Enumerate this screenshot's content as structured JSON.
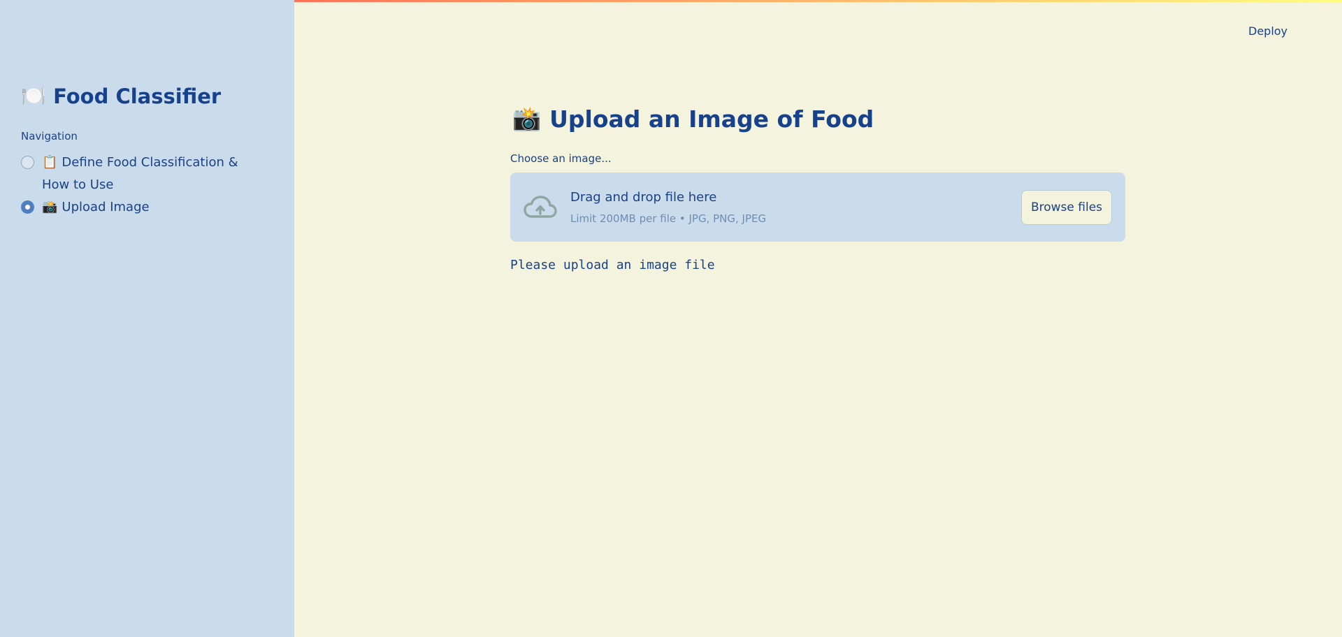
{
  "header": {
    "deploy_label": "Deploy"
  },
  "sidebar": {
    "title_icon": "🍽️",
    "title": "Food Classifier",
    "nav_label": "Navigation",
    "options": [
      {
        "icon": "📋",
        "label": "Define Food Classification & How to Use",
        "selected": false
      },
      {
        "icon": "📸",
        "label": "Upload Image",
        "selected": true
      }
    ]
  },
  "main": {
    "title_icon": "📸",
    "title": "Upload an Image of Food",
    "uploader": {
      "label": "Choose an image...",
      "drop_text": "Drag and drop file here",
      "limit_text": "Limit 200MB per file • JPG, PNG, JPEG",
      "browse_label": "Browse files",
      "icon": "cloud-upload-icon"
    },
    "message": "Please upload an image file"
  },
  "colors": {
    "background": "#f3f3de",
    "sidebar_background": "#cadcec",
    "text": "#1b4185",
    "accent": "#4f7fc0",
    "top_gradient_start": "#ff4b4b",
    "top_gradient_end": "#fffd80"
  }
}
